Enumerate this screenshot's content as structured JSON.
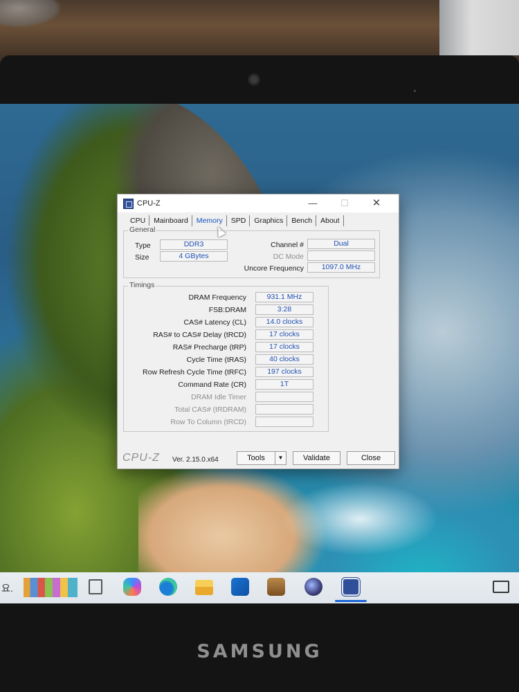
{
  "window": {
    "title": "CPU-Z",
    "controls": {
      "minimize": "—",
      "maximize": "☐",
      "close": "✕"
    }
  },
  "tabs": [
    {
      "label": "CPU"
    },
    {
      "label": "Mainboard"
    },
    {
      "label": "Memory",
      "active": true
    },
    {
      "label": "SPD"
    },
    {
      "label": "Graphics"
    },
    {
      "label": "Bench"
    },
    {
      "label": "About"
    }
  ],
  "general": {
    "group_label": "General",
    "type_label": "Type",
    "type_value": "DDR3",
    "size_label": "Size",
    "size_value": "4 GBytes",
    "channel_label": "Channel #",
    "channel_value": "Dual",
    "dc_mode_label": "DC Mode",
    "dc_mode_value": "",
    "uncore_label": "Uncore Frequency",
    "uncore_value": "1097.0 MHz"
  },
  "timings": {
    "group_label": "Timings",
    "rows": [
      {
        "label": "DRAM Frequency",
        "value": "931.1 MHz",
        "enabled": true
      },
      {
        "label": "FSB:DRAM",
        "value": "3:28",
        "enabled": true
      },
      {
        "label": "CAS# Latency (CL)",
        "value": "14.0 clocks",
        "enabled": true
      },
      {
        "label": "RAS# to CAS# Delay (tRCD)",
        "value": "17 clocks",
        "enabled": true
      },
      {
        "label": "RAS# Precharge (tRP)",
        "value": "17 clocks",
        "enabled": true
      },
      {
        "label": "Cycle Time (tRAS)",
        "value": "40 clocks",
        "enabled": true
      },
      {
        "label": "Row Refresh Cycle Time (tRFC)",
        "value": "197 clocks",
        "enabled": true
      },
      {
        "label": "Command Rate (CR)",
        "value": "1T",
        "enabled": true
      },
      {
        "label": "DRAM Idle Timer",
        "value": "",
        "enabled": false
      },
      {
        "label": "Total CAS# (tRDRAM)",
        "value": "",
        "enabled": false
      },
      {
        "label": "Row To Column (tRCD)",
        "value": "",
        "enabled": false
      }
    ]
  },
  "footer": {
    "logo": "CPU-Z",
    "version": "Ver. 2.15.0.x64",
    "tools_label": "Tools",
    "tools_arrow": "▼",
    "validate_label": "Validate",
    "close_label": "Close"
  },
  "taskbar": {
    "left_glyph": "요.",
    "icons": [
      "books-icon",
      "panel-icon",
      "copilot-icon",
      "edge-icon",
      "folder-icon",
      "outlook-icon",
      "winrar-icon",
      "globe-icon",
      "cpuz-icon",
      "tray-icon"
    ],
    "active_accent": "#1b64d8"
  },
  "device": {
    "brand": "SAMSUNG"
  },
  "colors": {
    "value_text": "#1f4fb3",
    "active_tab": "#1750c0",
    "window_bg": "#f0f0f0"
  }
}
